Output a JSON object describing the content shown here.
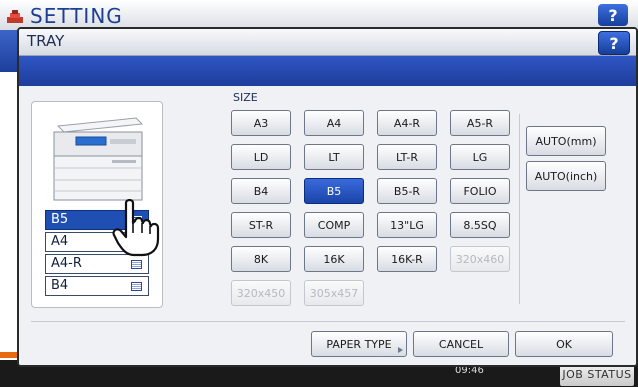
{
  "background": {
    "title": "SETTING",
    "help_label": "?",
    "time": "09:46",
    "job_status_label": "JOB STATUS"
  },
  "dialog": {
    "title": "TRAY",
    "help_label": "?"
  },
  "trays": [
    {
      "label": "B5",
      "selected": true
    },
    {
      "label": "A4",
      "selected": false
    },
    {
      "label": "A4-R",
      "selected": false
    },
    {
      "label": "B4",
      "selected": false
    }
  ],
  "size": {
    "label": "SIZE",
    "rows": [
      [
        "A3",
        "A4",
        "A4-R",
        "A5-R"
      ],
      [
        "LD",
        "LT",
        "LT-R",
        "LG"
      ],
      [
        "B4",
        "B5",
        "B5-R",
        "FOLIO"
      ],
      [
        "ST-R",
        "COMP",
        "13\"LG",
        "8.5SQ"
      ],
      [
        "8K",
        "16K",
        "16K-R",
        "320x460"
      ],
      [
        "320x450",
        "305x457"
      ]
    ],
    "selected": "B5",
    "disabled": [
      "320x460",
      "320x450",
      "305x457"
    ],
    "auto_mm": "AUTO(mm)",
    "auto_inch": "AUTO(inch)"
  },
  "footer": {
    "paper_type": "PAPER TYPE",
    "cancel": "CANCEL",
    "ok": "OK"
  },
  "colors": {
    "accent_blue": "#1f4fb3",
    "title_bar_blue": "#2f56c4"
  }
}
